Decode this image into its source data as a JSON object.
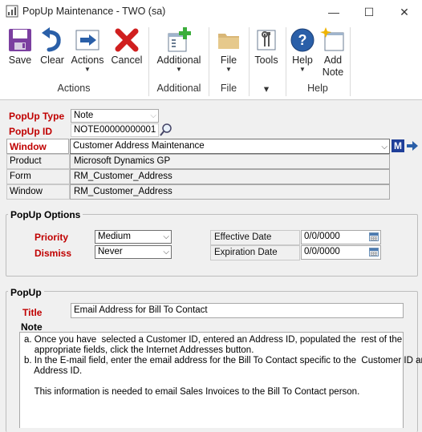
{
  "window": {
    "title": "PopUp Maintenance  -  TWO (sa)",
    "minimize_glyph": "—",
    "maximize_glyph": "☐",
    "close_glyph": "✕"
  },
  "ribbon": {
    "buttons": {
      "save": "Save",
      "clear": "Clear",
      "actions": "Actions",
      "cancel": "Cancel",
      "additional": "Additional",
      "file": "File",
      "tools": "Tools",
      "help": "Help",
      "add_note_1": "Add",
      "add_note_2": "Note"
    },
    "groups": {
      "actions": "Actions",
      "additional": "Additional",
      "file": "File",
      "tools": "▾",
      "help": "Help"
    },
    "icons": {
      "save": "save-disk-icon",
      "clear": "undo-arrow-icon",
      "actions": "arrow-right-icon",
      "cancel": "red-x-icon",
      "additional": "window-plus-icon",
      "file": "folder-icon",
      "tools": "tools-icon",
      "help": "help-question-icon",
      "add_note": "note-sparkle-icon"
    },
    "colors": {
      "accent": "#2a5fa8",
      "cancel_red": "#d01f1f",
      "add_green": "#3cae3c"
    }
  },
  "header": {
    "popup_type_label": "PopUp Type",
    "popup_type_value": "Note",
    "popup_id_label": "PopUp ID",
    "popup_id_value": "NOTE00000000001",
    "window_label": "Window",
    "window_value": "Customer Address Maintenance",
    "product_label": "Product",
    "product_value": "Microsoft Dynamics GP",
    "form_label": "Form",
    "form_value": "RM_Customer_Address",
    "window2_label": "Window",
    "window2_value": "RM_Customer_Address",
    "m_badge": "M"
  },
  "popup_options": {
    "title": "PopUp Options",
    "priority_label": "Priority",
    "priority_value": "Medium",
    "dismiss_label": "Dismiss",
    "dismiss_value": "Never",
    "effective_date_label": "Effective Date",
    "effective_date_value": "0/0/0000",
    "expiration_date_label": "Expiration Date",
    "expiration_date_value": "0/0/0000"
  },
  "popup": {
    "title": "PopUp",
    "title_label": "Title",
    "title_value": "Email Address for Bill To Contact",
    "note_label": "Note",
    "note_lines": [
      "a. Once you have  selected a Customer ID, entered an Address ID, populated the  rest of the",
      "    appropriate fields, click the Internet Addresses button.",
      "b. In the E-mail field, enter the email address for the Bill To Contact specific to the  Customer ID and",
      "    Address ID.",
      "",
      "    This information is needed to email Sales Invoices to the Bill To Contact person."
    ]
  }
}
